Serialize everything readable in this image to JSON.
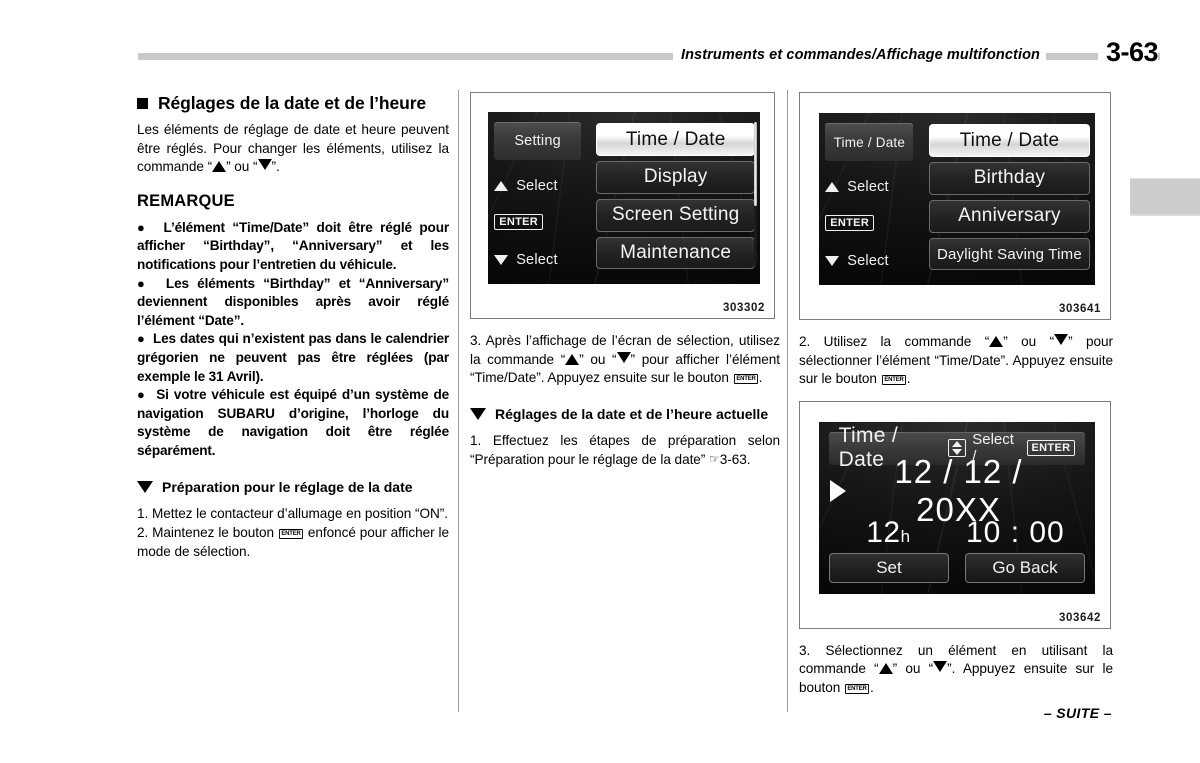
{
  "header": {
    "title": "Instruments et commandes/Affichage multifonction",
    "page_number": "3-63"
  },
  "footer": {
    "continued": "– SUITE –"
  },
  "left_column": {
    "heading": "Réglages de la date et de l’heure",
    "intro_a": "Les éléments de réglage de date et heure peuvent être réglés. Pour changer les éléments, utilisez la commande “",
    "intro_b": "” ou “",
    "intro_c": "”.",
    "note_heading": "REMARQUE",
    "notes": [
      "L’élément “Time/Date” doit être réglé pour afficher “Birthday”, “Anniversary” et les notifications pour l’entretien du véhicule.",
      "Les éléments “Birthday” et “Anniversary” deviennent disponibles après avoir réglé l’élément “Date”.",
      "Les dates qui n’existent pas dans le calendrier grégorien ne peuvent pas être réglées (par exemple le 31 Avril).",
      "Si votre véhicule est équipé d’un système de navigation SUBARU d’origine, l’horloge du système de navigation doit être réglée séparément."
    ],
    "prep_heading": "Préparation pour le réglage de la date",
    "step1": "1.  Mettez le contacteur d’allumage en position “ON”.",
    "step2_a": "2.  Maintenez le bouton ",
    "step2_b": " enfoncé pour afficher le mode de sélection."
  },
  "middle_column": {
    "figure": {
      "caption": "303302",
      "side": {
        "title": "Setting",
        "select_up": "Select",
        "enter": "ENTER",
        "select_down": "Select"
      },
      "menu": [
        {
          "label": "Time / Date",
          "selected": true
        },
        {
          "label": "Display",
          "selected": false
        },
        {
          "label": "Screen Setting",
          "selected": false
        },
        {
          "label": "Maintenance",
          "selected": false
        }
      ]
    },
    "step3_a": "3.  Après l’affichage de l’écran de sélection, utilisez la commande “",
    "step3_b": "” ou “",
    "step3_c": "” pour afficher l’élément “Time/Date”. Appuyez ensuite sur le bouton ",
    "step3_d": ".",
    "section_heading": "Réglages de la date et de l’heure actuelle",
    "step1_a": "1.  Effectuez les étapes de préparation selon “Préparation pour le réglage de la date” ",
    "step1_ref": "3-63.",
    "hand_icon": "☞"
  },
  "right_column": {
    "figure1": {
      "caption": "303641",
      "side": {
        "title": "Time / Date",
        "select_up": "Select",
        "enter": "ENTER",
        "select_down": "Select"
      },
      "menu": [
        {
          "label": "Time / Date",
          "selected": true
        },
        {
          "label": "Birthday",
          "selected": false
        },
        {
          "label": "Anniversary",
          "selected": false
        },
        {
          "label": "Daylight Saving Time",
          "selected": false
        }
      ]
    },
    "step2_a": "2.  Utilisez la commande “",
    "step2_b": "” ou “",
    "step2_c": "” pour sélectionner l’élément “Time/Date”. Appuyez ensuite sur le bouton ",
    "step2_d": ".",
    "figure2": {
      "caption": "303642",
      "title": "Time / Date",
      "select_label": "Select /",
      "enter": "ENTER",
      "date": "12 / 12 / 20XX",
      "hour_value": "12",
      "hour_unit": "h",
      "clock": "10 : 00",
      "set_button": "Set",
      "goback_button": "Go Back"
    },
    "step3_a": "3.  Sélectionnez un élément en utilisant la commande “",
    "step3_b": "” ou “",
    "step3_c": "”. Appuyez ensuite sur le bouton ",
    "step3_d": "."
  }
}
